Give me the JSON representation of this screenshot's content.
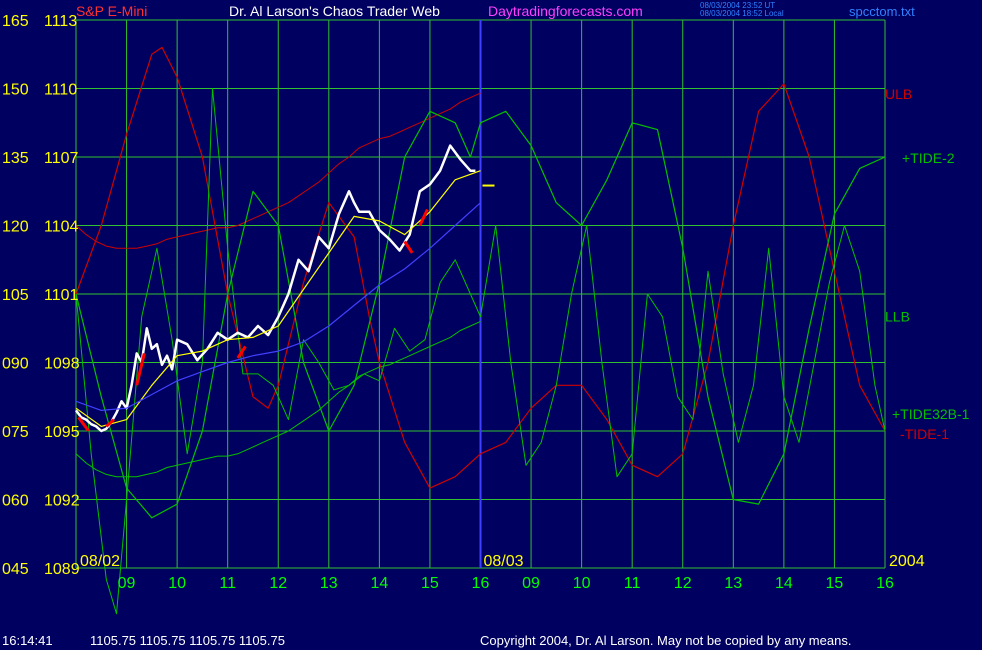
{
  "header": {
    "instrument": "S&P E-Mini",
    "title": "Dr. Al Larson's Chaos Trader Web",
    "site": "Daytradingforecasts.com",
    "stamp_ut": "08/03/2004 23:52 UT",
    "stamp_local": "08/03/2004 18:52 Local",
    "filename": "spcctom.txt"
  },
  "footer": {
    "time": "16:14:41",
    "quotes": "1105.75 1105.75 1105.75 1105.75",
    "copyright": "Copyright 2004, Dr. Al Larson. May not be copied by any means."
  },
  "colors": {
    "background": "#000060",
    "grid": "#30c030",
    "axis_text": "#ffff00",
    "hour_text": "#00ff00",
    "price": "#ffffff",
    "price_down": "#ff0000",
    "ma_short": "#ffff00",
    "ma_long": "#4040ff",
    "tide": "#00c000",
    "bands": "#d00000",
    "instrument_text": "#ff3030",
    "site_text": "#ff40ff",
    "filename_text": "#3080ff",
    "session_divider": "#4040ff"
  },
  "chart_data": {
    "type": "line",
    "left_scale": [
      "165",
      "150",
      "135",
      "120",
      "105",
      "090",
      "075",
      "060",
      "045"
    ],
    "price_scale": [
      "1113",
      "1110",
      "1107",
      "1104",
      "1101",
      "1098",
      "1095",
      "1092",
      "1089"
    ],
    "ylim_price": [
      1089,
      1113
    ],
    "ylim_left": [
      45,
      165
    ],
    "date_labels": [
      "08/02",
      "08/03"
    ],
    "year_label": "2004",
    "hour_labels": [
      "09",
      "10",
      "11",
      "12",
      "13",
      "14",
      "15",
      "16",
      "09",
      "10",
      "11",
      "12",
      "13",
      "14",
      "15",
      "16"
    ],
    "x_range": [
      0,
      16
    ],
    "series": [
      {
        "name": "ULB",
        "label": "ULB",
        "x": [
          0,
          0.2,
          0.4,
          0.6,
          0.8,
          1.0,
          1.2,
          1.4,
          1.6,
          1.8,
          2.0,
          2.2,
          2.4,
          2.6,
          2.8,
          3.0,
          3.2,
          3.4,
          3.6,
          3.8,
          4.0,
          4.2,
          4.4,
          4.6,
          4.8,
          5.0,
          5.2,
          5.4,
          5.6,
          5.8,
          6.0,
          6.2,
          6.4,
          6.6,
          6.8,
          7.0,
          7.2,
          7.4,
          7.6,
          7.8,
          8.0
        ],
        "y": [
          1104.0,
          1103.6,
          1103.3,
          1103.1,
          1103.0,
          1103.0,
          1103.0,
          1103.1,
          1103.2,
          1103.4,
          1103.5,
          1103.6,
          1103.7,
          1103.8,
          1103.9,
          1103.9,
          1104.0,
          1104.2,
          1104.4,
          1104.6,
          1104.8,
          1105.0,
          1105.3,
          1105.6,
          1105.9,
          1106.3,
          1106.7,
          1107.0,
          1107.4,
          1107.6,
          1107.8,
          1107.9,
          1108.1,
          1108.3,
          1108.5,
          1108.7,
          1108.9,
          1109.1,
          1109.4,
          1109.6,
          1109.8
        ]
      },
      {
        "name": "LLB",
        "label": "LLB",
        "x": [
          0,
          0.2,
          0.4,
          0.6,
          0.8,
          1.0,
          1.2,
          1.4,
          1.6,
          1.8,
          2.0,
          2.2,
          2.4,
          2.6,
          2.8,
          3.0,
          3.2,
          3.4,
          3.6,
          3.8,
          4.0,
          4.2,
          4.4,
          4.6,
          4.8,
          5.0,
          5.2,
          5.4,
          5.6,
          5.8,
          6.0,
          6.2,
          6.4,
          6.6,
          6.8,
          7.0,
          7.2,
          7.4,
          7.6,
          7.8,
          8.0
        ],
        "y": [
          1094.0,
          1093.6,
          1093.3,
          1093.1,
          1093.0,
          1093.0,
          1093.0,
          1093.1,
          1093.2,
          1093.4,
          1093.5,
          1093.6,
          1093.7,
          1093.8,
          1093.9,
          1093.9,
          1094.0,
          1094.2,
          1094.4,
          1094.6,
          1094.8,
          1095.0,
          1095.3,
          1095.6,
          1095.9,
          1096.3,
          1096.7,
          1097.0,
          1097.4,
          1097.6,
          1097.8,
          1097.9,
          1098.1,
          1098.3,
          1098.5,
          1098.7,
          1098.9,
          1099.1,
          1099.4,
          1099.6,
          1099.8
        ]
      },
      {
        "name": "-TIDE-1",
        "label": "-TIDE-1",
        "x": [
          0,
          0.5,
          1.0,
          1.5,
          1.7,
          2.0,
          2.5,
          3.0,
          3.5,
          3.8,
          4.0,
          4.5,
          5.0,
          5.5,
          5.8,
          6.0,
          6.5,
          7.0,
          7.5,
          8.0,
          8.5,
          9.0,
          9.5,
          10.0,
          10.5,
          11.0,
          11.5,
          12.0,
          12.5,
          13.0,
          13.5,
          14.0,
          14.5,
          15.0,
          15.5,
          16.0
        ],
        "y": [
          1101.0,
          1104.0,
          1108.0,
          1111.5,
          1111.8,
          1110.5,
          1107.0,
          1101.0,
          1096.5,
          1096.0,
          1097.0,
          1101.5,
          1105.0,
          1103.5,
          1100.0,
          1098.0,
          1094.5,
          1092.5,
          1093.0,
          1094.0,
          1094.5,
          1096.0,
          1097.0,
          1097.0,
          1095.5,
          1093.5,
          1093.0,
          1094.0,
          1098.0,
          1104.0,
          1109.0,
          1110.2,
          1107.0,
          1102.0,
          1097.0,
          1095.0
        ]
      },
      {
        "name": "+TIDE-2",
        "label": "+TIDE-2",
        "x": [
          0,
          0.5,
          1.0,
          1.5,
          2.0,
          2.5,
          3.0,
          3.5,
          4.0,
          4.5,
          5.0,
          5.5,
          6.0,
          6.5,
          7.0,
          7.5,
          7.8,
          8.0,
          8.5,
          9.0,
          9.5,
          10.0,
          10.5,
          11.0,
          11.5,
          12.0,
          12.5,
          13.0,
          13.5,
          14.0,
          14.5,
          15.0,
          15.5,
          16.0
        ],
        "y": [
          1101.0,
          1096.5,
          1092.5,
          1091.2,
          1091.8,
          1095.0,
          1101.0,
          1105.5,
          1104.0,
          1098.0,
          1095.0,
          1097.0,
          1101.5,
          1107.0,
          1109.0,
          1108.5,
          1107.0,
          1108.5,
          1109.0,
          1107.5,
          1105.0,
          1104.0,
          1106.0,
          1108.5,
          1108.2,
          1103.0,
          1096.5,
          1092.0,
          1091.8,
          1094.0,
          1099.5,
          1104.5,
          1106.5,
          1107.0
        ]
      },
      {
        "name": "+TIDE32B-1",
        "label": "+TIDE32B-1",
        "x": [
          0,
          0.3,
          0.6,
          0.8,
          1.0,
          1.3,
          1.6,
          1.9,
          2.2,
          2.5,
          2.7,
          3.0,
          3.3,
          3.6,
          3.9,
          4.2,
          4.5,
          4.8,
          5.1,
          5.4,
          5.7,
          6.0,
          6.3,
          6.6,
          6.9,
          7.2,
          7.5,
          7.8,
          8.0,
          8.3,
          8.6,
          8.9,
          9.2,
          9.5,
          9.8,
          10.1,
          10.4,
          10.7,
          11.0,
          11.3,
          11.6,
          11.9,
          12.2,
          12.5,
          12.8,
          13.1,
          13.4,
          13.7,
          14.0,
          14.3,
          14.6,
          14.9,
          15.2,
          15.5,
          15.8,
          16.0
        ],
        "y": [
          1101.0,
          1094.0,
          1088.5,
          1087.0,
          1092.0,
          1100.0,
          1103.0,
          1099.0,
          1094.0,
          1098.0,
          1110.0,
          1103.0,
          1097.5,
          1097.5,
          1097.0,
          1095.5,
          1099.0,
          1098.0,
          1096.8,
          1097.0,
          1097.5,
          1097.2,
          1099.5,
          1098.5,
          1099.0,
          1101.5,
          1102.5,
          1101.0,
          1100.0,
          1104.0,
          1098.0,
          1093.5,
          1094.5,
          1097.0,
          1101.0,
          1104.0,
          1098.0,
          1093.0,
          1094.0,
          1101.0,
          1100.0,
          1096.5,
          1095.5,
          1102.0,
          1097.5,
          1094.5,
          1097.0,
          1103.0,
          1096.5,
          1094.5,
          1098.0,
          1101.5,
          1104.0,
          1102.0,
          1097.0,
          1095.0
        ]
      },
      {
        "name": "price",
        "label": "",
        "x": [
          0,
          0.1,
          0.2,
          0.3,
          0.4,
          0.5,
          0.6,
          0.7,
          0.8,
          0.9,
          1.0,
          1.1,
          1.2,
          1.3,
          1.4,
          1.5,
          1.6,
          1.7,
          1.8,
          1.9,
          2.0,
          2.2,
          2.4,
          2.6,
          2.8,
          3.0,
          3.2,
          3.4,
          3.6,
          3.8,
          4.0,
          4.2,
          4.4,
          4.6,
          4.8,
          5.0,
          5.2,
          5.4,
          5.5,
          5.6,
          5.8,
          6.0,
          6.2,
          6.4,
          6.6,
          6.8,
          7.0,
          7.2,
          7.4,
          7.6,
          7.8,
          7.9
        ],
        "y": [
          1095.9,
          1095.6,
          1095.5,
          1095.3,
          1095.2,
          1095.0,
          1095.1,
          1095.4,
          1095.8,
          1096.3,
          1096.0,
          1097.0,
          1098.4,
          1098.0,
          1099.5,
          1098.6,
          1098.8,
          1097.9,
          1098.3,
          1097.7,
          1099.0,
          1098.8,
          1098.1,
          1098.6,
          1099.3,
          1099.0,
          1099.3,
          1099.1,
          1099.6,
          1099.2,
          1100.0,
          1101.0,
          1102.5,
          1102.0,
          1103.5,
          1103.0,
          1104.5,
          1105.5,
          1105.0,
          1104.6,
          1104.6,
          1103.8,
          1103.4,
          1102.9,
          1103.6,
          1105.5,
          1105.8,
          1106.4,
          1107.5,
          1106.9,
          1106.4,
          1106.4
        ]
      },
      {
        "name": "ma_short",
        "label": "",
        "x": [
          0,
          0.5,
          1.0,
          1.5,
          2.0,
          2.5,
          3.0,
          3.5,
          4.0,
          4.5,
          5.0,
          5.5,
          6.0,
          6.5,
          7.0,
          7.5,
          8.0
        ],
        "y": [
          1096.0,
          1095.2,
          1095.5,
          1097.0,
          1098.3,
          1098.5,
          1099.0,
          1099.1,
          1099.6,
          1101.2,
          1102.8,
          1104.4,
          1104.2,
          1103.6,
          1104.6,
          1106.0,
          1106.4
        ]
      },
      {
        "name": "ma_long",
        "label": "",
        "x": [
          0,
          0.5,
          1.0,
          1.5,
          2.0,
          2.5,
          3.0,
          3.5,
          4.0,
          4.5,
          5.0,
          5.5,
          6.0,
          6.5,
          7.0,
          7.5,
          8.0
        ],
        "y": [
          1096.3,
          1095.9,
          1096.0,
          1096.6,
          1097.2,
          1097.6,
          1098.0,
          1098.3,
          1098.5,
          1098.9,
          1099.6,
          1100.5,
          1101.4,
          1102.1,
          1103.0,
          1104.0,
          1105.0
        ]
      }
    ],
    "down_segments": [
      {
        "x": [
          0.05,
          0.25
        ],
        "y": [
          1095.6,
          1095.0
        ]
      },
      {
        "x": [
          0.6,
          0.75
        ],
        "y": [
          1095.2,
          1095.5
        ]
      },
      {
        "x": [
          1.2,
          1.35
        ],
        "y": [
          1097.0,
          1098.4
        ]
      },
      {
        "x": [
          3.2,
          3.35
        ],
        "y": [
          1098.2,
          1098.7
        ]
      },
      {
        "x": [
          6.5,
          6.65
        ],
        "y": [
          1103.3,
          1102.8
        ]
      },
      {
        "x": [
          6.8,
          6.95
        ],
        "y": [
          1104.0,
          1104.7
        ]
      }
    ],
    "last_price": 1105.75
  }
}
